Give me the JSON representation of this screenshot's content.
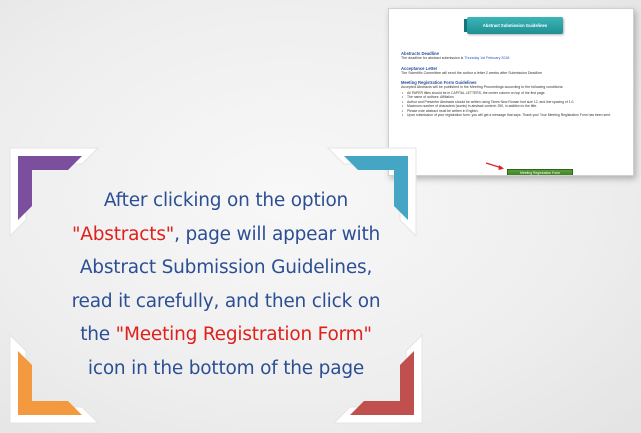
{
  "card": {
    "banner": "Abstract Submission Guidelines",
    "sections": [
      {
        "heading": "Abstracts Deadline",
        "lines": [
          {
            "pre": "The deadline for abstract submission is ",
            "link": "Thursday 1st February 2018",
            "post": ""
          }
        ]
      },
      {
        "heading": "Acceptance Letter",
        "lines": [
          {
            "pre": "The Scientific Committee will send the author a letter 2 weeks after Submission Deadline",
            "link": "",
            "post": ""
          }
        ]
      },
      {
        "heading": "Meeting Registration Form Guidelines",
        "lines": [
          {
            "pre": "Accepted Abstracts will be published in the Meeting Proceedings according to the following conditions:",
            "link": "",
            "post": ""
          }
        ]
      }
    ],
    "items": [
      "All PAPER titles should be in CAPITAL LETTERS, the center column on top of the first page.",
      "The name of authors: Affiliation",
      "Author and Presenter Abstracts should be written using Times New Roman font size 12, and line spacing of 1.0.",
      "Maximum number of characters (words) in abstract content: 250, in addition to the title.",
      "Please note abstract must be written in English.",
      "Upon submission of your registration form, you will get a message that says: Thank you! Your Meeting Registration Form has been sent."
    ],
    "button_label": "Meeting Registration Form"
  },
  "instructions": {
    "line1": "After clicking  on the option",
    "line2_quote": "\"Abstracts\"",
    "line2_rest": ",  page will appear with",
    "line3": "Abstract Submission Guidelines,",
    "line4": "read it carefully, and then click on",
    "line5_pre": "the ",
    "line5_quote": "\"Meeting Registration Form\"",
    "line6": "icon  in the bottom of the page"
  },
  "colors": {
    "text": "#2c4f94",
    "highlight": "#e0201b",
    "corner_top_left": "#7b4f9e",
    "corner_top_right": "#45a5c4",
    "corner_bottom_left": "#f39a41",
    "corner_bottom_right": "#c0504d",
    "banner": "#2aa3a6",
    "button": "#4a8f2c"
  }
}
